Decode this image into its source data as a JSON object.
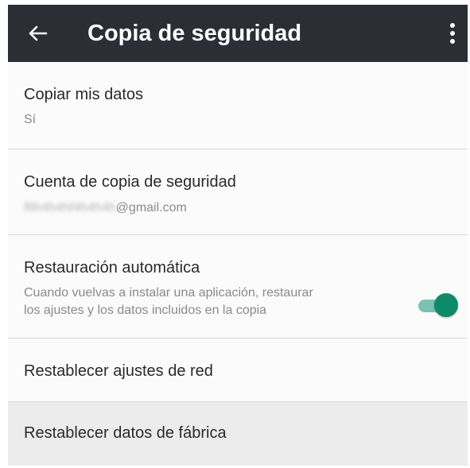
{
  "toolbar": {
    "title": "Copia de seguridad",
    "back_icon": "arrow-back-icon",
    "overflow_icon": "more-vert-icon",
    "background": "#2b2e35"
  },
  "settings": {
    "backup_data": {
      "title": "Copiar mis datos",
      "value": "Sí"
    },
    "backup_account": {
      "title": "Cuenta de copia de seguridad",
      "email_hidden_part": "f8h4h4hf4h4h4h",
      "email_domain": "@gmail.com"
    },
    "auto_restore": {
      "title": "Restauración automática",
      "description_line1": "Cuando vuelvas a instalar una aplicación, restaurar",
      "description_line2": "los ajustes y los datos incluidos en la copia",
      "enabled": true,
      "toggle_color": "#0f8a68"
    },
    "reset_network": {
      "title": "Restablecer ajustes de red"
    },
    "factory_reset": {
      "title": "Restablecer datos de fábrica"
    }
  }
}
